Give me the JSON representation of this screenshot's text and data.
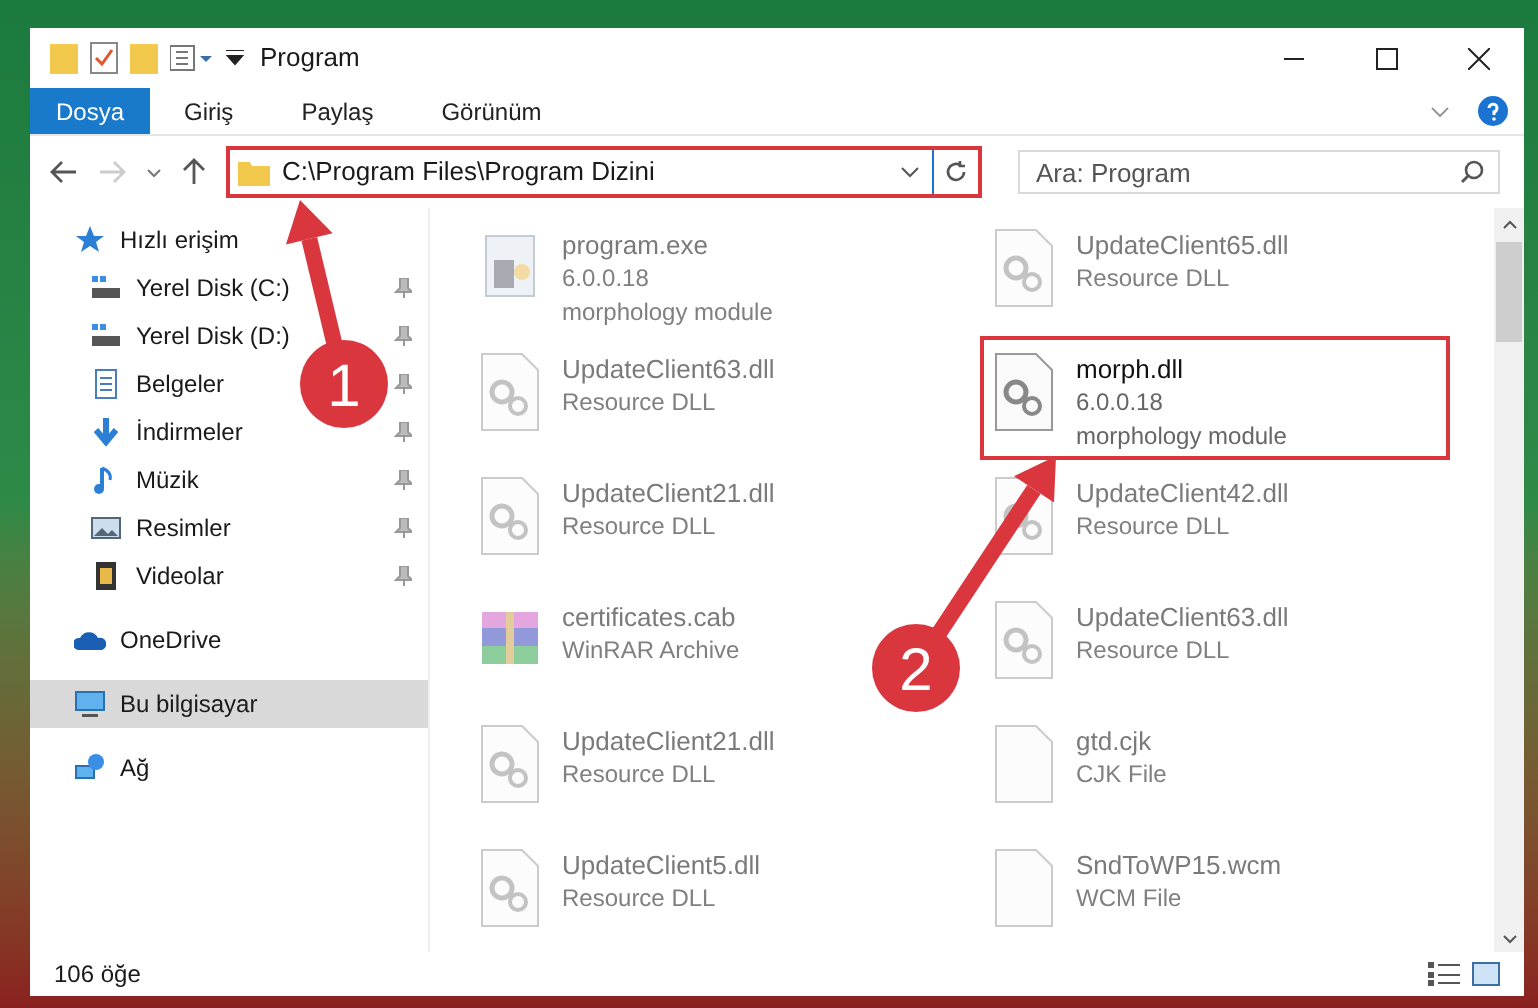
{
  "window": {
    "title": "Program"
  },
  "ribbon_tabs": [
    {
      "label": "Dosya",
      "selected": true
    },
    {
      "label": "Giriş",
      "selected": false
    },
    {
      "label": "Paylaş",
      "selected": false
    },
    {
      "label": "Görünüm",
      "selected": false
    }
  ],
  "address_bar": {
    "path": "C:\\Program Files\\Program Dizini",
    "highlighted": true
  },
  "search": {
    "placeholder": "Ara: Program"
  },
  "sidebar": {
    "items": [
      {
        "label": "Hızlı erişim",
        "kind": "star",
        "selected": false,
        "children": [
          {
            "label": "Yerel Disk (C:)",
            "kind": "drive",
            "pinned": true,
            "selected": false
          },
          {
            "label": "Yerel Disk (D:)",
            "kind": "drive",
            "pinned": true,
            "selected": false
          },
          {
            "label": "Belgeler",
            "kind": "document",
            "pinned": true,
            "selected": false
          },
          {
            "label": "İndirmeler",
            "kind": "download",
            "pinned": true,
            "selected": false
          },
          {
            "label": "Müzik",
            "kind": "music",
            "pinned": true,
            "selected": false
          },
          {
            "label": "Resimler",
            "kind": "picture",
            "pinned": true,
            "selected": false
          },
          {
            "label": "Videolar",
            "kind": "video",
            "pinned": true,
            "selected": false
          }
        ]
      },
      {
        "label": "OneDrive",
        "kind": "cloud",
        "selected": false
      },
      {
        "label": "Bu bilgisayar",
        "kind": "computer",
        "selected": true
      },
      {
        "label": "Ağ",
        "kind": "network",
        "selected": false
      }
    ]
  },
  "files": [
    {
      "name": "program.exe",
      "details": [
        "6.0.0.18",
        "morphology module"
      ],
      "kind": "exe",
      "faded": true,
      "highlighted": false
    },
    {
      "name": "UpdateClient65.dll",
      "details": [
        "Resource DLL"
      ],
      "kind": "dll",
      "faded": true,
      "highlighted": false
    },
    {
      "name": "UpdateClient63.dll",
      "details": [
        "Resource DLL"
      ],
      "kind": "dll",
      "faded": true,
      "highlighted": false
    },
    {
      "name": "morph.dll",
      "details": [
        "6.0.0.18",
        "morphology module"
      ],
      "kind": "dll",
      "faded": false,
      "highlighted": true
    },
    {
      "name": "UpdateClient21.dll",
      "details": [
        "Resource DLL"
      ],
      "kind": "dll",
      "faded": true,
      "highlighted": false
    },
    {
      "name": "UpdateClient42.dll",
      "details": [
        "Resource DLL"
      ],
      "kind": "dll",
      "faded": true,
      "highlighted": false
    },
    {
      "name": "certificates.cab",
      "details": [
        "WinRAR Archive"
      ],
      "kind": "cab",
      "faded": true,
      "highlighted": false
    },
    {
      "name": "UpdateClient63.dll",
      "details": [
        "Resource DLL"
      ],
      "kind": "dll",
      "faded": true,
      "highlighted": false
    },
    {
      "name": "UpdateClient21.dll",
      "details": [
        "Resource DLL"
      ],
      "kind": "dll",
      "faded": true,
      "highlighted": false
    },
    {
      "name": "gtd.cjk",
      "details": [
        "CJK File"
      ],
      "kind": "file",
      "faded": true,
      "highlighted": false
    },
    {
      "name": "UpdateClient5.dll",
      "details": [
        "Resource DLL"
      ],
      "kind": "dll",
      "faded": true,
      "highlighted": false
    },
    {
      "name": "SndToWP15.wcm",
      "details": [
        "WCM File"
      ],
      "kind": "file",
      "faded": true,
      "highlighted": false
    }
  ],
  "status_bar": {
    "item_count": "106 öğe"
  },
  "annotations": [
    {
      "number": "1"
    },
    {
      "number": "2"
    }
  ]
}
